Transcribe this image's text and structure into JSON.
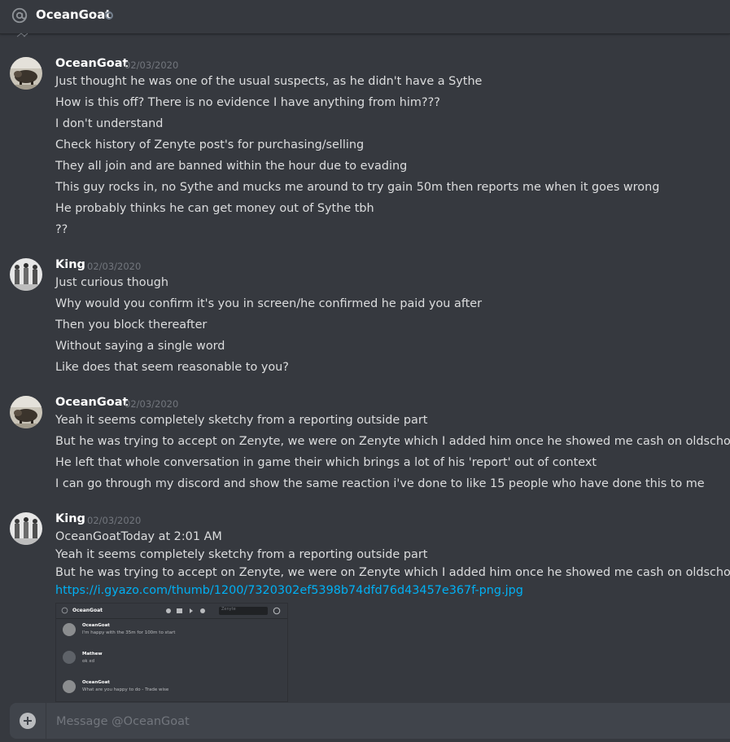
{
  "header": {
    "title": "OceanGoat",
    "icon": "at-icon",
    "status": "offline"
  },
  "messages": [
    {
      "author": "OceanGoat",
      "timestamp": "02/03/2020",
      "lines": [
        "Just thought he was one of the usual suspects, as he didn't have a Sythe",
        "How is this off? There is no evidence I have anything from him???",
        "I don't understand",
        "Check history of Zenyte post's for purchasing/selling",
        "They all join and are banned within the hour due to evading",
        "This guy rocks in, no Sythe and mucks me around to try gain 50m then reports me when it goes wrong",
        "He probably thinks he can get money out of Sythe tbh",
        "??"
      ]
    },
    {
      "author": "King",
      "timestamp": "02/03/2020",
      "lines": [
        "Just curious though",
        "Why would you confirm it's you in screen/he confirmed he paid you after",
        "Then you block thereafter",
        "Without saying a single word",
        "Like does that seem reasonable to you?"
      ]
    },
    {
      "author": "OceanGoat",
      "timestamp": "02/03/2020",
      "lines": [
        "Yeah it seems completely sketchy from a reporting outside part",
        "But he was trying to accept on Zenyte, we were on Zenyte which I added him once he showed me cash on oldschool",
        "He left that whole conversation in game their which brings a lot of his 'report' out of context",
        "I can go through my discord and show the same reaction i've done to like 15 people who have done this to me"
      ]
    },
    {
      "author": "King",
      "timestamp": "02/03/2020",
      "lines": [
        "OceanGoatToday at 2:01 AM",
        "Yeah it seems completely sketchy from a reporting outside part",
        "But he was trying to accept on Zenyte, we were on Zenyte which I added him once he showed me cash on oldschool"
      ],
      "link": "https://i.gyazo.com/thumb/1200/7320302ef5398b74dfd76d43457e367f-png.jpg",
      "embed": {
        "title": "OceanGoat",
        "search": "Zenyte",
        "entries": [
          {
            "name": "OceanGoat",
            "text": "I'm happy with the 35m for 100m to start"
          },
          {
            "name": "Mathew",
            "text": "ok xd"
          },
          {
            "name": "OceanGoat",
            "text": "What are you happy to do - Trade wise"
          }
        ]
      }
    }
  ],
  "composer": {
    "placeholder": "Message @OceanGoat"
  },
  "colors": {
    "background": "#36393f",
    "link": "#00b0f4",
    "input": "#40444b"
  }
}
